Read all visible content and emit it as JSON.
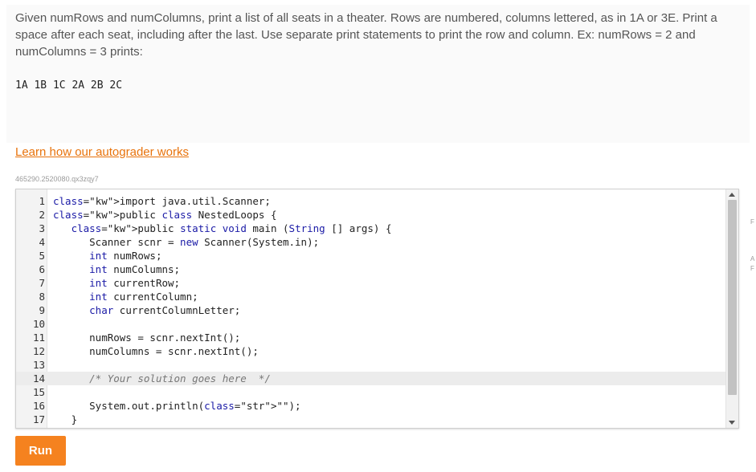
{
  "prompt": {
    "text": "Given numRows and numColumns, print a list of all seats in a theater. Rows are numbered, columns lettered, as in 1A or 3E. Print a space after each seat, including after the last. Use separate print statements to print the row and column. Ex: numRows = 2 and numColumns = 3 prints:",
    "example_output": "1A 1B 1C 2A 2B 2C"
  },
  "learn_link": "Learn how our autograder works",
  "lab_id": "465290.2520080.qx3zqy7",
  "editor": {
    "active_line": 14,
    "lines": [
      {
        "num": "1",
        "text": "import java.util.Scanner;"
      },
      {
        "num": "2",
        "text": "public class NestedLoops {"
      },
      {
        "num": "3",
        "text": "   public static void main (String [] args) {"
      },
      {
        "num": "4",
        "text": "      Scanner scnr = new Scanner(System.in);"
      },
      {
        "num": "5",
        "text": "      int numRows;"
      },
      {
        "num": "6",
        "text": "      int numColumns;"
      },
      {
        "num": "7",
        "text": "      int currentRow;"
      },
      {
        "num": "8",
        "text": "      int currentColumn;"
      },
      {
        "num": "9",
        "text": "      char currentColumnLetter;"
      },
      {
        "num": "10",
        "text": ""
      },
      {
        "num": "11",
        "text": "      numRows = scnr.nextInt();"
      },
      {
        "num": "12",
        "text": "      numColumns = scnr.nextInt();"
      },
      {
        "num": "13",
        "text": ""
      },
      {
        "num": "14",
        "text": "      /* Your solution goes here  */"
      },
      {
        "num": "15",
        "text": ""
      },
      {
        "num": "16",
        "text": "      System.out.println(\"\");"
      },
      {
        "num": "17",
        "text": "   }"
      }
    ]
  },
  "run_button": "Run",
  "edge_marks": [
    "F",
    "A",
    "F"
  ],
  "colors": {
    "accent": "#f5821f",
    "link": "#e8730c"
  }
}
